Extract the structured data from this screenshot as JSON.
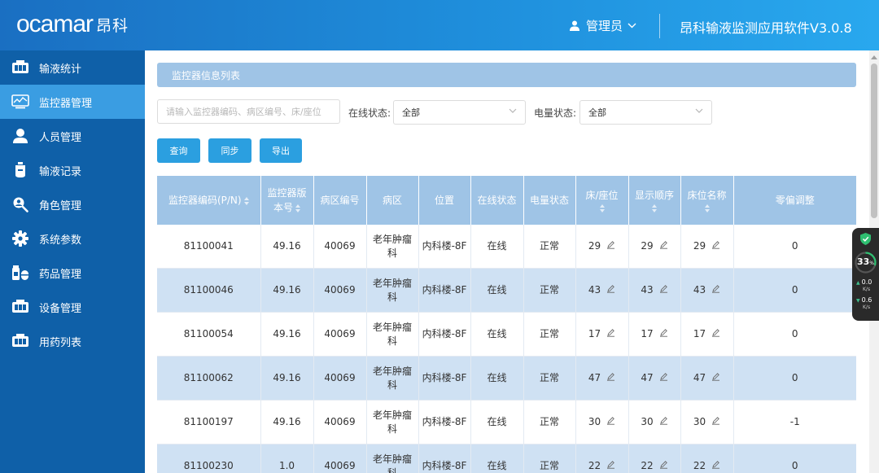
{
  "header": {
    "logo_latin": "ocamar",
    "logo_cn": "昂科",
    "user_label": "管理员",
    "app_title": "昂科输液监测应用软件V3.0.8"
  },
  "sidebar": {
    "items": [
      {
        "label": "输液统计",
        "icon": "infusion-stats-icon"
      },
      {
        "label": "监控器管理",
        "icon": "monitor-icon",
        "active": true
      },
      {
        "label": "人员管理",
        "icon": "person-icon"
      },
      {
        "label": "输液记录",
        "icon": "infusion-bag-icon"
      },
      {
        "label": "角色管理",
        "icon": "role-search-icon"
      },
      {
        "label": "系统参数",
        "icon": "gear-icon"
      },
      {
        "label": "药品管理",
        "icon": "medicine-icon"
      },
      {
        "label": "设备管理",
        "icon": "device-icon"
      },
      {
        "label": "用药列表",
        "icon": "medication-list-icon"
      }
    ]
  },
  "main": {
    "section_title": "监控器信息列表",
    "search_placeholder": "请输入监控器编码、病区编号、床/座位",
    "online_label": "在线状态:",
    "online_value": "全部",
    "battery_label": "电量状态:",
    "battery_value": "全部",
    "buttons": {
      "query": "查询",
      "sync": "同步",
      "export": "导出"
    }
  },
  "table": {
    "headers": [
      "监控器编码(P/N)",
      "监控器版本号",
      "病区编号",
      "病区",
      "位置",
      "在线状态",
      "电量状态",
      "床/座位",
      "显示顺序",
      "床位名称",
      "零偏调整"
    ],
    "rows": [
      [
        "81100041",
        "49.16",
        "40069",
        "老年肿瘤科",
        "内科楼-8F",
        "在线",
        "正常",
        "29",
        "29",
        "29",
        "0"
      ],
      [
        "81100046",
        "49.16",
        "40069",
        "老年肿瘤科",
        "内科楼-8F",
        "在线",
        "正常",
        "43",
        "43",
        "43",
        "0"
      ],
      [
        "81100054",
        "49.16",
        "40069",
        "老年肿瘤科",
        "内科楼-8F",
        "在线",
        "正常",
        "17",
        "17",
        "17",
        "0"
      ],
      [
        "81100062",
        "49.16",
        "40069",
        "老年肿瘤科",
        "内科楼-8F",
        "在线",
        "正常",
        "47",
        "47",
        "47",
        "0"
      ],
      [
        "81100197",
        "49.16",
        "40069",
        "老年肿瘤科",
        "内科楼-8F",
        "在线",
        "正常",
        "30",
        "30",
        "30",
        "-1"
      ],
      [
        "81100230",
        "1.0",
        "40069",
        "老年肿瘤科",
        "内科楼-8F",
        "在线",
        "正常",
        "22",
        "22",
        "22",
        "0"
      ]
    ]
  },
  "widget": {
    "percent": "33",
    "percent_unit": "%",
    "up_rate": "0.0",
    "down_rate": "0.6",
    "rate_unit": "K/s"
  },
  "colors": {
    "header_start": "#1a6fc2",
    "header_end": "#29a8ee",
    "sidebar": "#0f60a8",
    "sidebar_active": "#3a9de2",
    "table_header": "#9fc4e6",
    "row_alt": "#cfe1f3",
    "button": "#2b9fe0"
  }
}
